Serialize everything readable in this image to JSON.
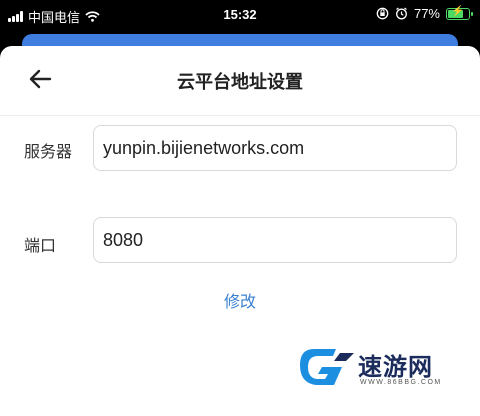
{
  "status_bar": {
    "carrier": "中国电信",
    "time": "15:32",
    "battery_text": "77%",
    "battery_level": 0.77,
    "battery_color": "#4cd964"
  },
  "nav": {
    "title": "云平台地址设置",
    "back_icon": "back-arrow-icon"
  },
  "form": {
    "server": {
      "label": "服务器",
      "value": "yunpin.bijienetworks.com"
    },
    "port": {
      "label": "端口",
      "value": "8080"
    }
  },
  "actions": {
    "modify_label": "修改",
    "link_color": "#3a80d2"
  },
  "watermark": {
    "name": "速游网",
    "url": "WWW.86BBG.COM"
  },
  "colors": {
    "header_strip": "#3f7de0"
  }
}
